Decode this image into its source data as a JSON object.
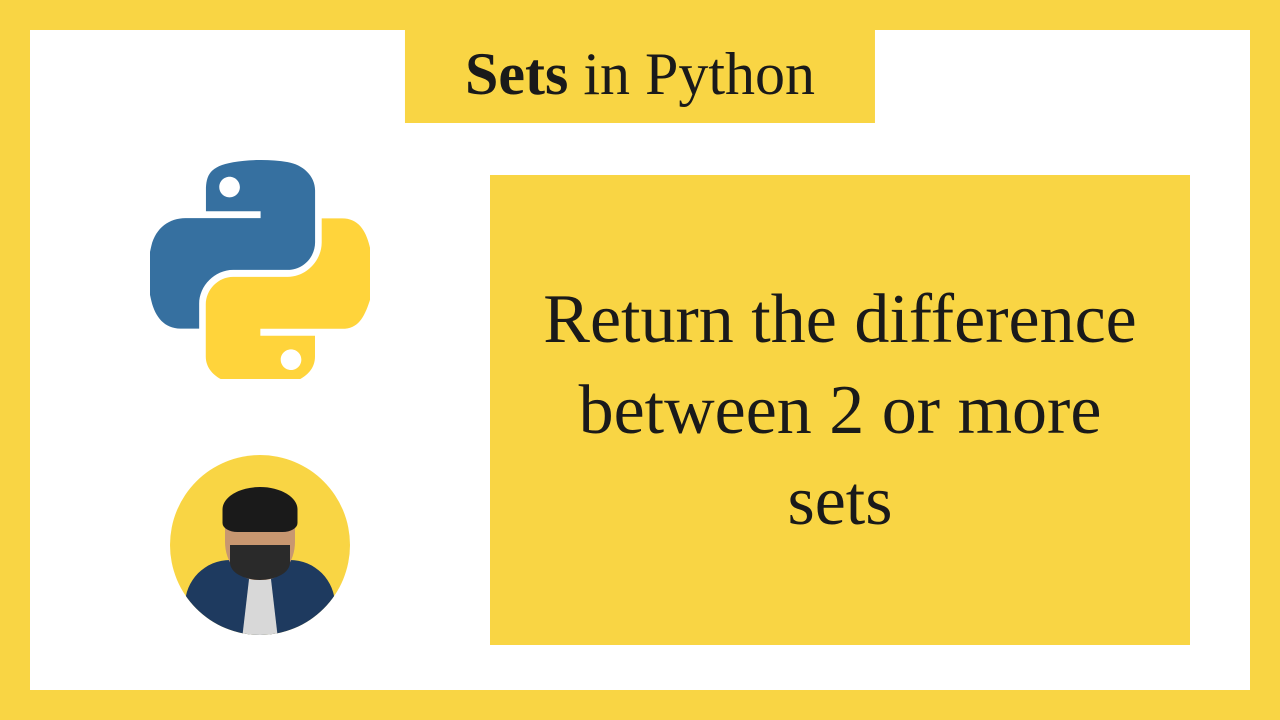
{
  "title": {
    "bold": "Sets",
    "rest": " in Python"
  },
  "content": "Return the difference between 2 or more sets",
  "colors": {
    "bg": "#f9d544",
    "inner": "#ffffff",
    "text": "#1a1a1a",
    "python_blue": "#3670a0",
    "python_yellow": "#ffd43b"
  }
}
